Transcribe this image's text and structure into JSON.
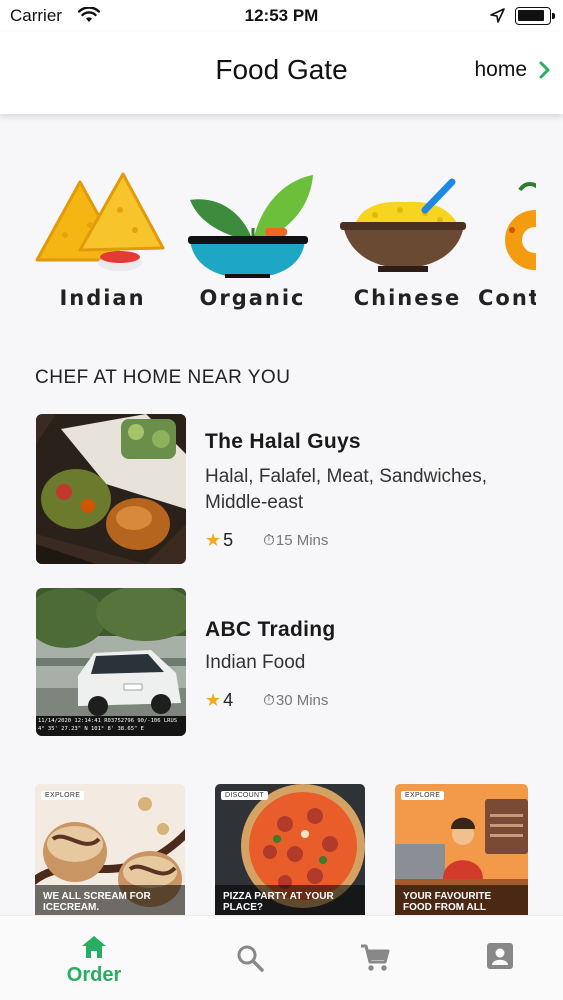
{
  "status_bar": {
    "carrier": "Carrier",
    "time": "12:53 PM"
  },
  "header": {
    "title": "Food Gate",
    "location": "home"
  },
  "categories": [
    {
      "label": "Indian",
      "icon": "samosa-icon"
    },
    {
      "label": "Organic",
      "icon": "plant-bowl-icon"
    },
    {
      "label": "Chinese",
      "icon": "rice-bowl-icon"
    },
    {
      "label": "Cont",
      "icon": "continental-icon"
    }
  ],
  "section_title": "CHEF AT HOME NEAR YOU",
  "chefs": [
    {
      "name": "The Halal Guys",
      "cuisine": "Halal, Falafel, Meat, Sandwiches, Middle-east",
      "rating": "5",
      "eta": "15 Mins"
    },
    {
      "name": "ABC Trading",
      "cuisine": "Indian Food",
      "rating": "4",
      "eta": "30 Mins",
      "photo_overlay": "11/14/2020 12:14:41 R03752796 90/-106 LRUS 4° 35' 27.23\" N 101° 8' 38.65\" E"
    }
  ],
  "promos": [
    {
      "badge": "EXPLORE",
      "caption": "WE ALL SCREAM FOR ICECREAM."
    },
    {
      "badge": "DISCOUNT",
      "caption": "PIZZA PARTY AT YOUR PLACE?"
    },
    {
      "badge": "EXPLORE",
      "caption": "YOUR FAVOURITE FOOD FROM ALL"
    }
  ],
  "nav": {
    "order_label": "Order",
    "active_color": "#27ae60",
    "inactive_color": "#888888",
    "items": [
      "home-icon",
      "search-icon",
      "cart-icon",
      "account-icon"
    ]
  }
}
